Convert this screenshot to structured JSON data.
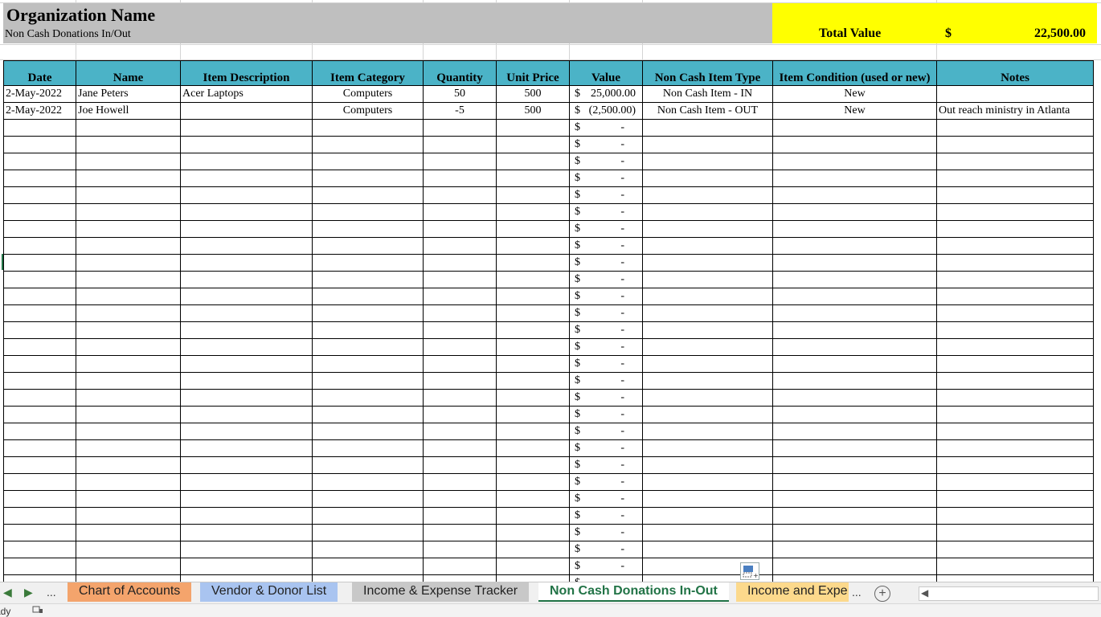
{
  "header": {
    "org_name": "Organization Name",
    "subtitle": "Non Cash Donations In/Out",
    "total_label": "Total Value",
    "total_currency": "$",
    "total_value": "22,500.00",
    "colors": {
      "title_bg": "#bfbfbf",
      "total_bg": "#ffff00",
      "header_bg": "#4bb3c7"
    }
  },
  "table": {
    "columns": [
      "Date",
      "Name",
      "Item Description",
      "Item Category",
      "Quantity",
      "Unit Price",
      "Value",
      "Non Cash Item Type",
      "Item Condition (used or new)",
      "Notes"
    ],
    "rows": [
      {
        "date": "2-May-2022",
        "name": "Jane Peters",
        "description": "Acer Laptops",
        "category": "Computers",
        "quantity": "50",
        "unit_price": "500",
        "value_cur": "$",
        "value_amt": "25,000.00",
        "type": "Non Cash Item - IN",
        "condition": "New",
        "notes": ""
      },
      {
        "date": "2-May-2022",
        "name": "Joe Howell",
        "description": "",
        "category": "Computers",
        "quantity": "-5",
        "unit_price": "500",
        "value_cur": "$",
        "value_amt": "(2,500.00)",
        "type": "Non Cash Item - OUT",
        "condition": "New",
        "notes": "Out reach ministry in Atlanta"
      }
    ],
    "empty_value_cur": "$",
    "empty_value_amt": "-"
  },
  "tabs": {
    "nav_prev": "◀",
    "nav_next": "▶",
    "nav_more": "...",
    "items": [
      {
        "label": "Chart of Accounts",
        "color": "#f4a46c"
      },
      {
        "label": "Vendor & Donor List",
        "color": "#a9c4f0"
      },
      {
        "label": "Income & Expense Tracker",
        "color": "#c8c8c8"
      },
      {
        "label": "Non Cash Donations In-Out",
        "color": "#ffffff"
      },
      {
        "label": "Income and Expe",
        "color": "#fcd98c"
      }
    ],
    "more_right": "...",
    "add_sheet": "+",
    "icons": [
      "chevron-left-icon",
      "chevron-right-icon",
      "add-sheet-icon",
      "paste-options-icon"
    ]
  },
  "status": {
    "text": "ady"
  }
}
